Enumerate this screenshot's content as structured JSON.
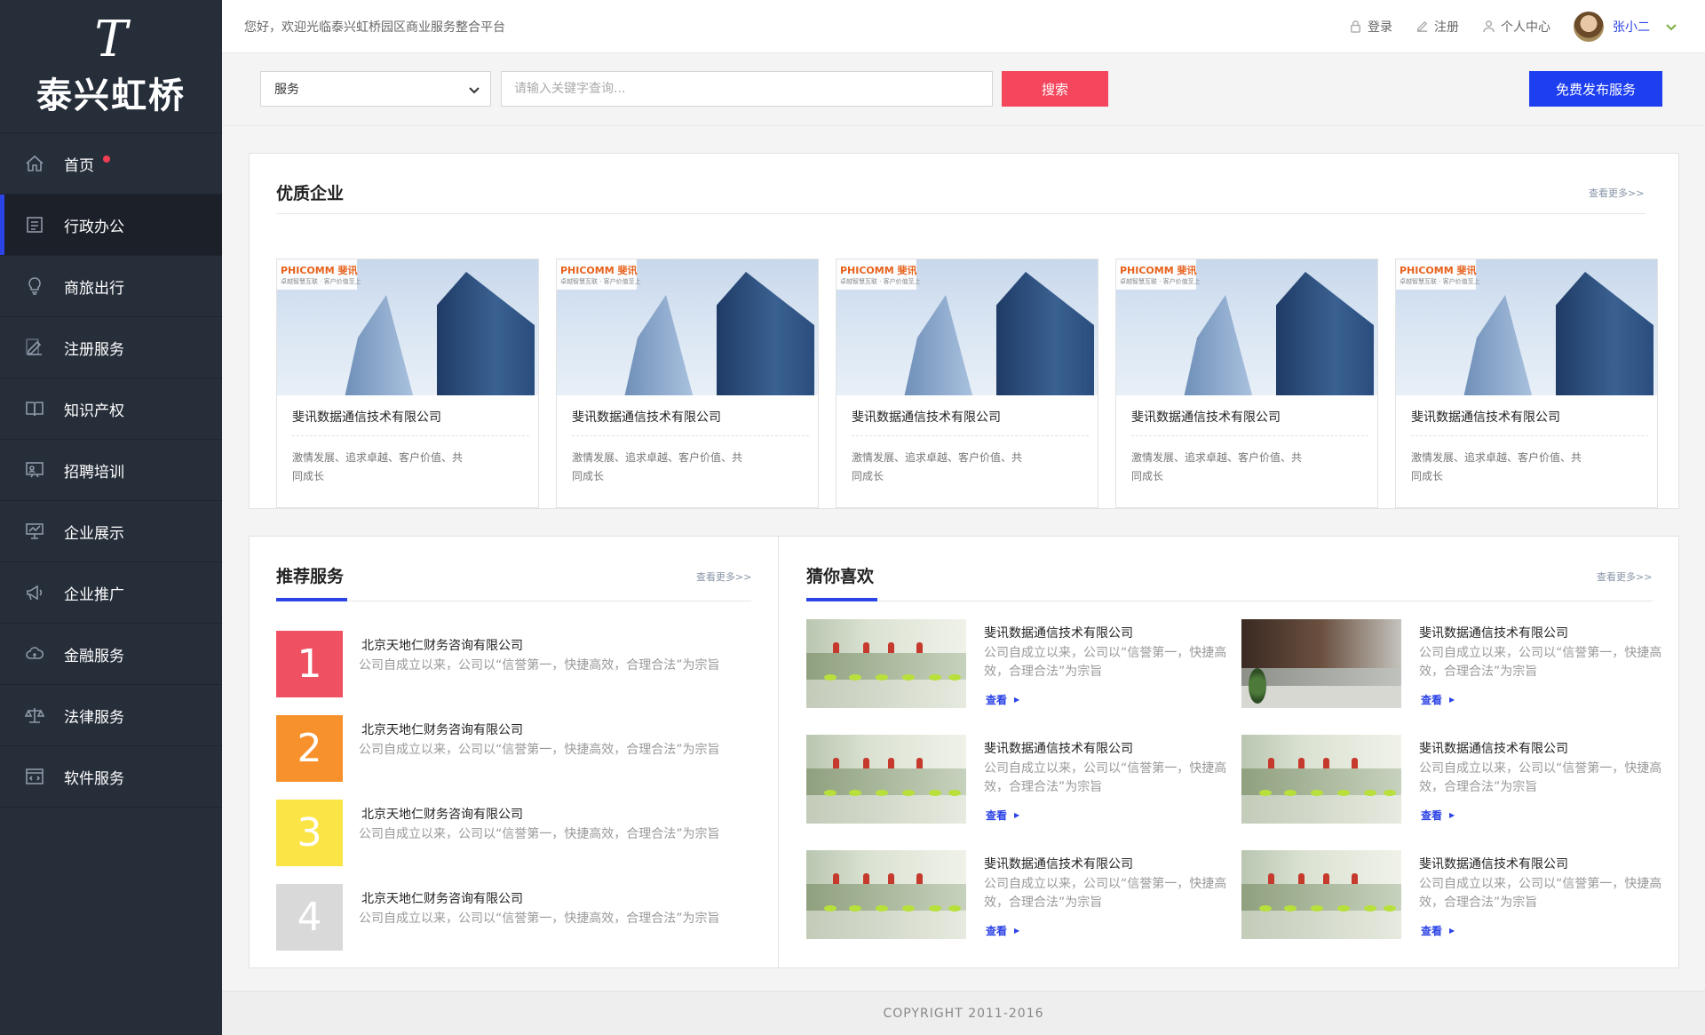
{
  "brand": {
    "mark": "T",
    "name": "泰兴虹桥"
  },
  "sidebar": {
    "items": [
      {
        "label": "首页",
        "icon": "home-icon",
        "badge": true
      },
      {
        "label": "行政办公",
        "icon": "document-icon",
        "active": true
      },
      {
        "label": "商旅出行",
        "icon": "lightbulb-icon"
      },
      {
        "label": "注册服务",
        "icon": "edit-icon"
      },
      {
        "label": "知识产权",
        "icon": "book-icon"
      },
      {
        "label": "招聘培训",
        "icon": "presentation-icon"
      },
      {
        "label": "企业展示",
        "icon": "display-board-icon"
      },
      {
        "label": "企业推广",
        "icon": "megaphone-icon"
      },
      {
        "label": "金融服务",
        "icon": "cloud-money-icon"
      },
      {
        "label": "法律服务",
        "icon": "scales-icon"
      },
      {
        "label": "软件服务",
        "icon": "code-window-icon"
      }
    ]
  },
  "topbar": {
    "welcome": "您好，欢迎光临泰兴虹桥园区商业服务整合平台",
    "login": "登录",
    "register": "注册",
    "personal_center": "个人中心",
    "username": "张小二"
  },
  "search": {
    "category": "服务",
    "placeholder": "请输入关键字查询...",
    "button": "搜索",
    "publish_button": "免费发布服务"
  },
  "quality": {
    "title": "优质企业",
    "more": "查看更多>>",
    "companies": [
      {
        "brand_en": "PHICOMM",
        "brand_cn": "斐讯",
        "slogan": "卓越智慧互联 · 客户价值至上",
        "name": "斐讯数据通信技术有限公司",
        "desc": "激情发展、追求卓越、客户价值、共同成长"
      },
      {
        "brand_en": "PHICOMM",
        "brand_cn": "斐讯",
        "slogan": "卓越智慧互联 · 客户价值至上",
        "name": "斐讯数据通信技术有限公司",
        "desc": "激情发展、追求卓越、客户价值、共同成长"
      },
      {
        "brand_en": "PHICOMM",
        "brand_cn": "斐讯",
        "slogan": "卓越智慧互联 · 客户价值至上",
        "name": "斐讯数据通信技术有限公司",
        "desc": "激情发展、追求卓越、客户价值、共同成长"
      },
      {
        "brand_en": "PHICOMM",
        "brand_cn": "斐讯",
        "slogan": "卓越智慧互联 · 客户价值至上",
        "name": "斐讯数据通信技术有限公司",
        "desc": "激情发展、追求卓越、客户价值、共同成长"
      },
      {
        "brand_en": "PHICOMM",
        "brand_cn": "斐讯",
        "slogan": "卓越智慧互联 · 客户价值至上",
        "name": "斐讯数据通信技术有限公司",
        "desc": "激情发展、追求卓越、客户价值、共同成长"
      }
    ]
  },
  "recommend": {
    "title": "推荐服务",
    "more": "查看更多>>",
    "items": [
      {
        "rank": "1",
        "color": "#ef5062",
        "title": "北京天地仁财务咨询有限公司",
        "desc": "公司自成立以来，公司以“信誉第一，快捷高效，合理合法”为宗旨"
      },
      {
        "rank": "2",
        "color": "#f7912c",
        "title": "北京天地仁财务咨询有限公司",
        "desc": "公司自成立以来，公司以“信誉第一，快捷高效，合理合法”为宗旨"
      },
      {
        "rank": "3",
        "color": "#fbe445",
        "title": "北京天地仁财务咨询有限公司",
        "desc": "公司自成立以来，公司以“信誉第一，快捷高效，合理合法”为宗旨"
      },
      {
        "rank": "4",
        "color": "#d9d9d9",
        "title": "北京天地仁财务咨询有限公司",
        "desc": "公司自成立以来，公司以“信誉第一，快捷高效，合理合法”为宗旨"
      }
    ]
  },
  "guess": {
    "title": "猜你喜欢",
    "more": "查看更多>>",
    "items": [
      {
        "title": "斐讯数据通信技术有限公司",
        "desc": "公司自成立以来，公司以“信誉第一，快捷高效，合理合法”为宗旨",
        "view": "查看"
      },
      {
        "title": "斐讯数据通信技术有限公司",
        "desc": "公司自成立以来，公司以“信誉第一，快捷高效，合理合法”为宗旨",
        "view": "查看"
      },
      {
        "title": "斐讯数据通信技术有限公司",
        "desc": "公司自成立以来，公司以“信誉第一，快捷高效，合理合法”为宗旨",
        "view": "查看"
      },
      {
        "title": "斐讯数据通信技术有限公司",
        "desc": "公司自成立以来，公司以“信誉第一，快捷高效，合理合法”为宗旨",
        "view": "查看"
      },
      {
        "title": "斐讯数据通信技术有限公司",
        "desc": "公司自成立以来，公司以“信誉第一，快捷高效，合理合法”为宗旨",
        "view": "查看"
      },
      {
        "title": "斐讯数据通信技术有限公司",
        "desc": "公司自成立以来，公司以“信誉第一，快捷高效，合理合法”为宗旨",
        "view": "查看"
      }
    ]
  },
  "footer": {
    "copyright": "COPYRIGHT 2011-2016"
  },
  "colors": {
    "accent": "#2c43e6",
    "search": "#f4465c",
    "publish": "#1e3ff0",
    "sidebar": "#262e3a"
  }
}
